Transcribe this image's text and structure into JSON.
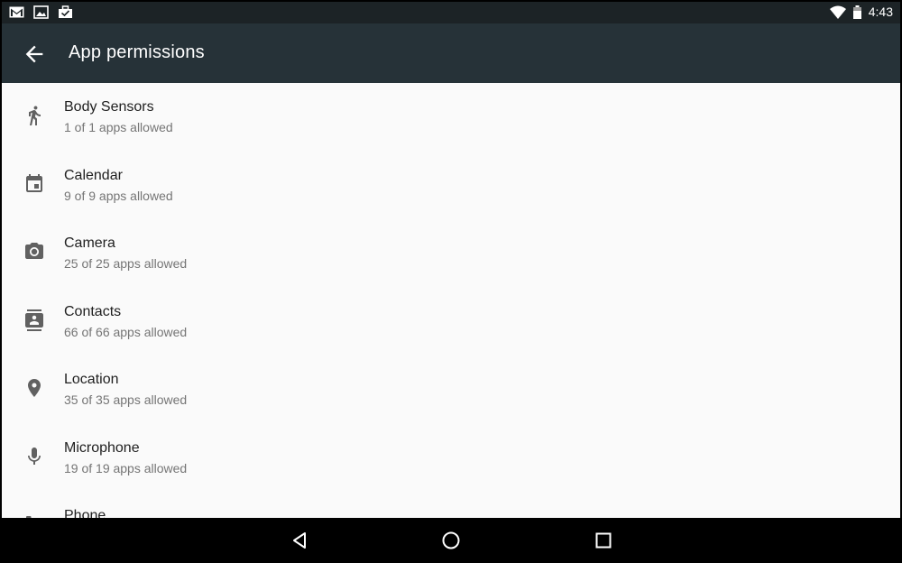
{
  "status_bar": {
    "notification_icons": [
      "gmail-icon",
      "image-icon",
      "briefcase-icon"
    ],
    "system_icons": [
      "wifi-icon",
      "battery-icon"
    ],
    "time": "4:43"
  },
  "app_bar": {
    "title": "App permissions",
    "back_icon": "arrow-back-icon"
  },
  "permissions": [
    {
      "label": "Body Sensors",
      "summary": "1 of 1 apps allowed",
      "icon": "walking-person-icon"
    },
    {
      "label": "Calendar",
      "summary": "9 of 9 apps allowed",
      "icon": "calendar-icon"
    },
    {
      "label": "Camera",
      "summary": "25 of 25 apps allowed",
      "icon": "camera-icon"
    },
    {
      "label": "Contacts",
      "summary": "66 of 66 apps allowed",
      "icon": "contacts-icon"
    },
    {
      "label": "Location",
      "summary": "35 of 35 apps allowed",
      "icon": "location-pin-icon"
    },
    {
      "label": "Microphone",
      "summary": "19 of 19 apps allowed",
      "icon": "microphone-icon"
    },
    {
      "label": "Phone",
      "summary": "",
      "icon": "phone-icon"
    }
  ],
  "nav_bar": {
    "buttons": [
      "back-triangle-icon",
      "home-circle-icon",
      "recents-square-icon"
    ]
  },
  "colors": {
    "status_bar": "#1c2326",
    "app_bar": "#263238",
    "list_background": "#fafafa",
    "primary_text": "#212121",
    "secondary_text": "#757575",
    "icon": "#616161"
  }
}
